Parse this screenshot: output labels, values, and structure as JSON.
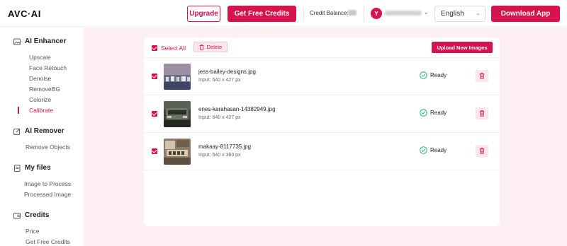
{
  "header": {
    "logo": "AVC·AI",
    "upgrade_label": "Upgrade",
    "get_credits_label": "Get Free Credits",
    "credit_balance_label": "Credit Balance:",
    "avatar_initial": "Y",
    "language": "English",
    "download_label": "Download App"
  },
  "sidebar": {
    "sections": [
      {
        "title": "AI Enhancer",
        "icon": "image-icon",
        "items": [
          "Upscale",
          "Face Retouch",
          "Denoise",
          "RemoveBG",
          "Colorize",
          "Calibrate"
        ],
        "active": "Calibrate"
      },
      {
        "title": "AI Remover",
        "icon": "edit-icon",
        "items": [
          "Remove Objects"
        ]
      },
      {
        "title": "My files",
        "icon": "files-icon",
        "items": [
          "Image to Process",
          "Processed Image"
        ]
      },
      {
        "title": "Credits",
        "icon": "wallet-icon",
        "items": [
          "Price",
          "Get Free Credits"
        ]
      }
    ]
  },
  "toolbar": {
    "select_all_label": "Select All",
    "delete_label": "Delete",
    "upload_label": "Upload New Images"
  },
  "files": [
    {
      "name": "jess-bailey-designs.jpg",
      "meta": "Input: 640 x 427 px",
      "status": "Ready"
    },
    {
      "name": "enes-karahasan-14382949.jpg",
      "meta": "Input: 640 x 427 px",
      "status": "Ready"
    },
    {
      "name": "makaay-8117735.jpg",
      "meta": "Input: 640 x 360 px",
      "status": "Ready"
    }
  ],
  "colors": {
    "accent": "#d6124f",
    "main_bg": "#fdeff2",
    "success": "#2bb673"
  }
}
